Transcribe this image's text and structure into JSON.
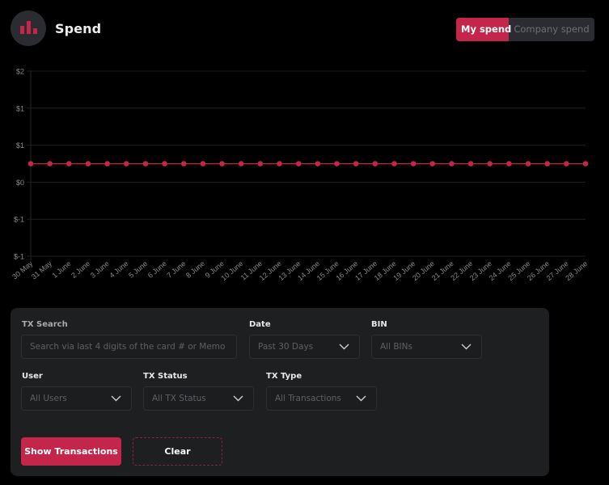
{
  "header": {
    "title": "Spend",
    "logo_icon": "bar-chart-icon",
    "toggle": {
      "options": [
        "My spend",
        "Company spend"
      ],
      "active": "My spend"
    }
  },
  "colors": {
    "accent": "#c3264a",
    "background": "#000000",
    "panel": "#1e1f21",
    "gridline": "#1f1f1f",
    "tick_label": "#8a8a8a"
  },
  "chart_data": {
    "type": "line",
    "title": "",
    "xlabel": "",
    "ylabel": "",
    "x": [
      "30 May",
      "31 May",
      "1 June",
      "2 June",
      "3 June",
      "4 June",
      "5 June",
      "6 June",
      "7 June",
      "8 June",
      "9 June",
      "10 June",
      "11 June",
      "12 June",
      "13 June",
      "14 June",
      "15 June",
      "16 June",
      "17 June",
      "18 June",
      "19 June",
      "20 June",
      "21 June",
      "22 June",
      "23 June",
      "24 June",
      "25 June",
      "26 June",
      "27 June",
      "28 June"
    ],
    "series": [
      {
        "name": "My spend",
        "values": [
          0,
          0,
          0,
          0,
          0,
          0,
          0,
          0,
          0,
          0,
          0,
          0,
          0,
          0,
          0,
          0,
          0,
          0,
          0,
          0,
          0,
          0,
          0,
          0,
          0,
          0,
          0,
          0,
          0,
          0
        ]
      }
    ],
    "ylim": [
      -1,
      1
    ],
    "yticks": [
      1,
      0.6,
      0.2,
      -0.2,
      -0.6,
      -1
    ],
    "ytick_values": [
      -1,
      -0.6,
      -0.2,
      0.2,
      0.6,
      1
    ],
    "ytick_labels": [
      "$2",
      "$1",
      "$1",
      "$0",
      "$-1",
      "$-1"
    ],
    "grid": true,
    "legend": "none"
  },
  "filters": {
    "tx_search": {
      "label": "TX Search",
      "value": "",
      "placeholder": "Search via last 4 digits of the card # or Memo"
    },
    "date": {
      "label": "Date",
      "value": "Past 30 Days"
    },
    "bin": {
      "label": "BIN",
      "value": "All BINs"
    },
    "user": {
      "label": "User",
      "value": "All Users"
    },
    "tx_status": {
      "label": "TX Status",
      "value": "All TX Status"
    },
    "tx_type": {
      "label": "TX Type",
      "value": "All Transactions"
    }
  },
  "actions": {
    "show_label": "Show Transactions",
    "clear_label": "Clear"
  }
}
